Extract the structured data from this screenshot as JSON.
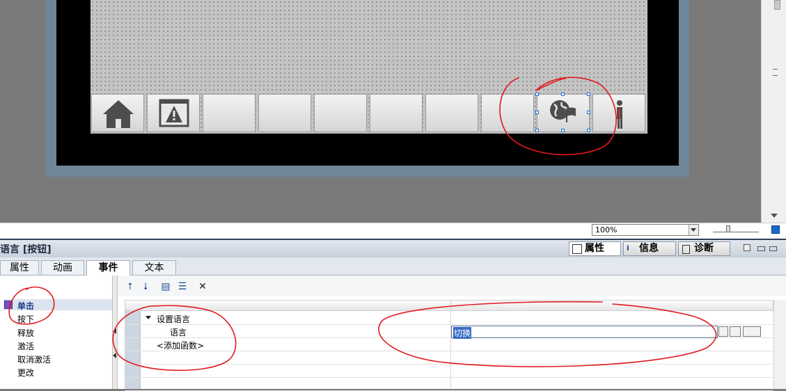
{
  "zoom": {
    "value": "100%"
  },
  "inspector": {
    "title": "语言 [按钮]",
    "top_tabs": [
      {
        "label": "属性",
        "icon": "properties-icon"
      },
      {
        "label": "信息",
        "icon": "info-icon"
      },
      {
        "label": "诊断",
        "icon": "diagnostics-icon"
      }
    ],
    "sub_tabs": [
      "属性",
      "动画",
      "事件",
      "文本"
    ],
    "active_sub_tab": "事件"
  },
  "events": {
    "items": [
      "单击",
      "按下",
      "释放",
      "激活",
      "取消激活",
      "更改"
    ],
    "selected": "单击"
  },
  "function_list": {
    "function_name": "设置语言",
    "param_name": "语言",
    "param_value": "切换",
    "add_function": "<添加函数>"
  },
  "hmi": {
    "function_keys": [
      "home-icon",
      "alarm-window-icon",
      "",
      "",
      "",
      "",
      "",
      "",
      "language-globe-flag-icon",
      "user-icon"
    ]
  },
  "colors": {
    "annotation": "#e0191e",
    "frame": "#6f8598",
    "selection_handle": "#1a6fd4",
    "highlight_value": "#3a6bc7"
  }
}
